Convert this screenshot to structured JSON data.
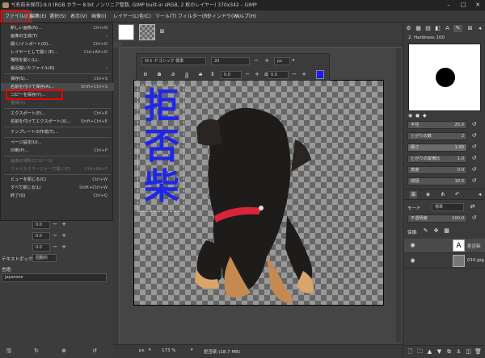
{
  "window": {
    "title": "*[名前未保存]-9.0 (RGB カラー 8 bit ノンリニア整数, GIMP built-in sRGB, 2 枚のレイヤー) 370x342 – GIMP",
    "minimize": "–",
    "maximize": "□",
    "close": "✕"
  },
  "menubar": {
    "items": [
      "ファイル(F)",
      "編集(E)",
      "選択(S)",
      "表示(V)",
      "画像(I)",
      "レイヤー(L)",
      "色(C)",
      "ツール(T)",
      "フィルター(R)",
      "ウィンドウ(W)",
      "ヘルプ(H)"
    ]
  },
  "file_menu": {
    "items": [
      {
        "label": "新しい画像(N)...",
        "shortcut": "Ctrl+N",
        "disabled": false
      },
      {
        "label": "画像の生成(T)",
        "shortcut": "›",
        "disabled": false
      },
      {
        "label": "開く/インポート(O)...",
        "shortcut": "Ctrl+O",
        "disabled": false
      },
      {
        "label": "レイヤーとして開く(E)...",
        "shortcut": "Ctrl+Alt+O",
        "disabled": false
      },
      {
        "label": "場所を開く(L)...",
        "shortcut": "",
        "disabled": false
      },
      {
        "label": "最近開いたファイル(R)",
        "shortcut": "›",
        "disabled": false
      },
      {
        "label": "保存(S)...",
        "shortcut": "Ctrl+S",
        "disabled": false
      },
      {
        "label": "名前を付けて保存(A)...",
        "shortcut": "Shift+Ctrl+S",
        "disabled": false
      },
      {
        "label": "コピーを保存(Y)...",
        "shortcut": "",
        "disabled": false
      },
      {
        "label": "復帰(V)",
        "shortcut": "",
        "disabled": true
      },
      {
        "label": "エクスポート(E)...",
        "shortcut": "Ctrl+E",
        "disabled": false
      },
      {
        "label": "名前を付けてエクスポート(X)...",
        "shortcut": "Shift+Ctrl+E",
        "disabled": false
      },
      {
        "label": "テンプレートの作成(T)...",
        "shortcut": "",
        "disabled": false
      },
      {
        "label": "ページ設定(U)...",
        "shortcut": "",
        "disabled": false
      },
      {
        "label": "印刷(P)...",
        "shortcut": "Ctrl+P",
        "disabled": false
      },
      {
        "label": "画像の場所のコピー(I)",
        "shortcut": "",
        "disabled": true
      },
      {
        "label": "ファイルマネージャーで開く(F)",
        "shortcut": "Ctrl+Alt+F",
        "disabled": true
      },
      {
        "label": "ビューを閉じる(C)",
        "shortcut": "Ctrl+W",
        "disabled": false
      },
      {
        "label": "すべて閉じる(L)",
        "shortcut": "Shift+Ctrl+W",
        "disabled": false
      },
      {
        "label": "終了(Q)",
        "shortcut": "Ctrl+Q",
        "disabled": false
      }
    ]
  },
  "text_options": {
    "font": "ＭＳ Ｐゴシック 標準",
    "size": "20",
    "unit": "px",
    "indent": "0.0",
    "spacing": "0.0",
    "color": "#1a1aff"
  },
  "left_panel": {
    "rows": [
      {
        "value": "0.0"
      },
      {
        "value": "0.0"
      },
      {
        "value": "0.0"
      }
    ],
    "textbox_label": "テキストボックス",
    "textbox_value": "固動的",
    "lang_label": "言語:",
    "lang_value": "Japanese"
  },
  "canvas": {
    "text_chars": [
      "拒",
      "否",
      "柴"
    ],
    "text_color": "#1f27e6"
  },
  "statusbar": {
    "unit": "px",
    "zoom": "173 %",
    "info": "拒否柴 (18.7 MB)"
  },
  "brush_panel": {
    "brush_name": "2. Hardness 100",
    "sliders": [
      {
        "label": "半径",
        "value": "25.0"
      },
      {
        "label": "とがりの数",
        "value": "2"
      },
      {
        "label": "硬さ",
        "value": "1.00"
      },
      {
        "label": "とがりの縦横比",
        "value": "1.0"
      },
      {
        "label": "角度",
        "value": "0.0"
      },
      {
        "label": "間隔",
        "value": "10.0"
      }
    ]
  },
  "layers_panel": {
    "mode_label": "モード",
    "mode_value": "標準",
    "opacity_label": "不透明度",
    "opacity_value": "100.0",
    "lock_label": "保護:",
    "layers": [
      {
        "name": "拒否柴",
        "type": "text"
      },
      {
        "name": "010.jpg",
        "type": "image"
      }
    ]
  }
}
